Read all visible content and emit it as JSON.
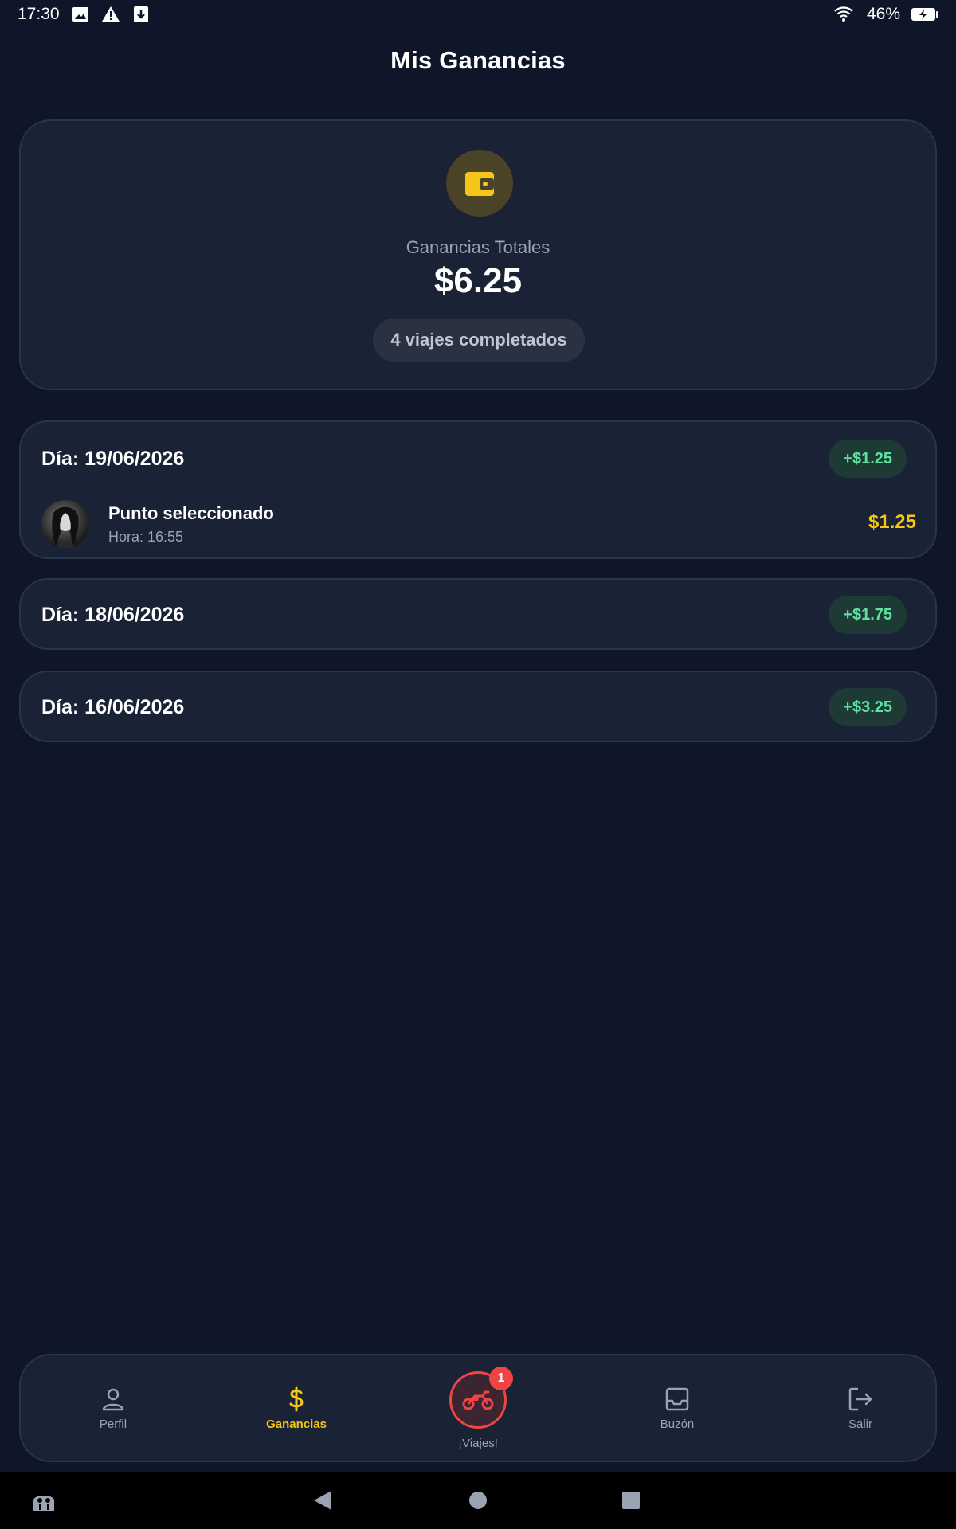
{
  "status_bar": {
    "time": "17:30",
    "battery": "46%"
  },
  "header": {
    "title": "Mis Ganancias"
  },
  "summary": {
    "label": "Ganancias Totales",
    "amount": "$6.25",
    "trips_completed": "4 viajes completados",
    "icon": "wallet-icon"
  },
  "days": [
    {
      "date": "Día: 19/06/2026",
      "total": "+$1.25",
      "trips": [
        {
          "name": "Punto seleccionado",
          "time": "Hora: 16:55",
          "amount": "$1.25"
        }
      ]
    },
    {
      "date": "Día: 18/06/2026",
      "total": "+$1.75",
      "trips": []
    },
    {
      "date": "Día: 16/06/2026",
      "total": "+$3.25",
      "trips": []
    }
  ],
  "nav": {
    "perfil": "Perfil",
    "ganancias": "Ganancias",
    "viajes": "¡Viajes!",
    "viajes_badge": "1",
    "buzon": "Buzón",
    "salir": "Salir"
  },
  "colors": {
    "background": "#0f1629",
    "card": "#1a2335",
    "accent": "#f5c518",
    "positive": "#5ee0a0",
    "alert": "#ef4444"
  }
}
